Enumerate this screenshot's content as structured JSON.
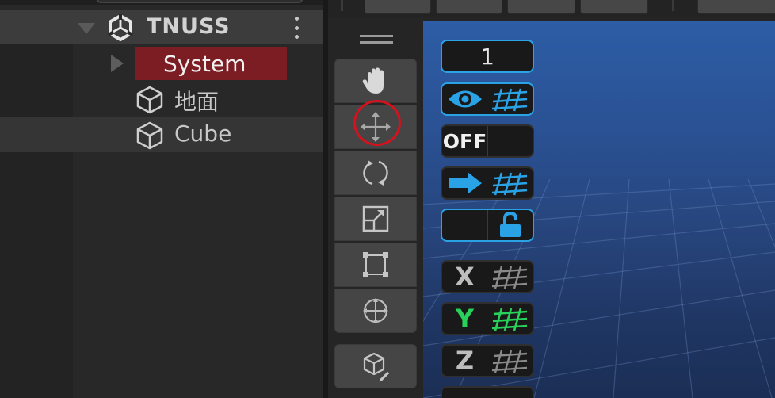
{
  "hierarchy": {
    "scene_name": "TNUSS",
    "items": [
      {
        "label": "System"
      },
      {
        "label": "地面"
      },
      {
        "label": "Cube"
      }
    ]
  },
  "overlays": {
    "layer_count": "1",
    "toggle_off_label": "OFF",
    "axis_x": "X",
    "axis_y": "Y",
    "axis_z": "Z"
  },
  "colors": {
    "accent": "#2aa2e6",
    "selection": "#7b1d22",
    "highlight_ring": "#d4121d",
    "axis_y": "#28d25a"
  },
  "icons": [
    "unity-logo-icon",
    "more-vert-icon",
    "cube-icon",
    "hand-tool-icon",
    "move-tool-icon",
    "rotate-tool-icon",
    "scale-tool-icon",
    "rect-tool-icon",
    "transform-tool-icon",
    "custom-tool-icon",
    "eye-icon",
    "grid-icon",
    "arrow-right-icon",
    "unlock-icon"
  ]
}
